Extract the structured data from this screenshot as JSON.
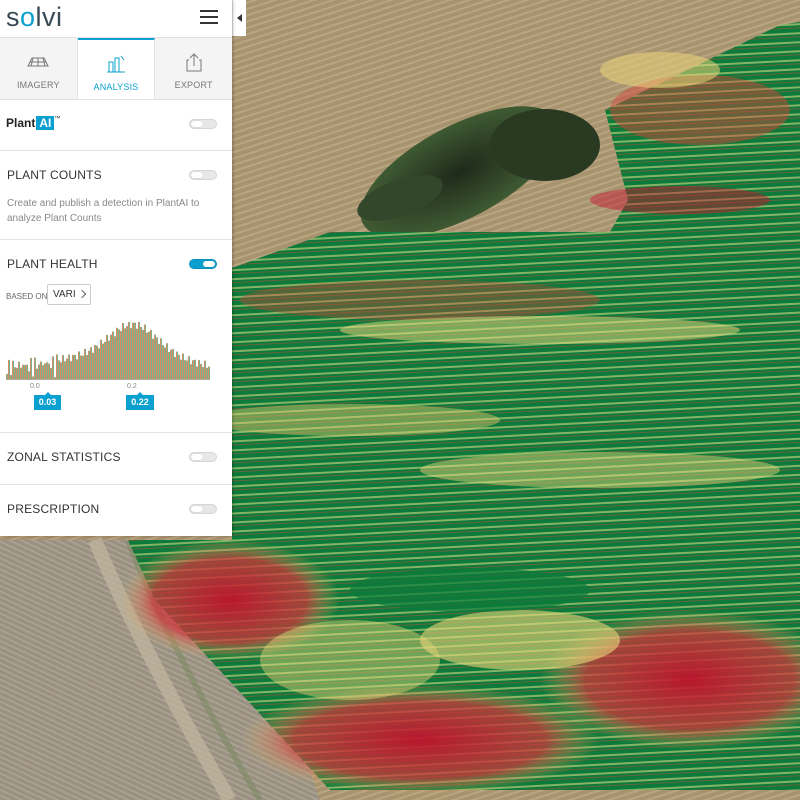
{
  "app": {
    "logo_text": "solvi",
    "menu_icon": "hamburger-icon",
    "collapse_icon": "caret-left-icon"
  },
  "tabs": [
    {
      "label": "IMAGERY",
      "icon": "drone-grid-icon",
      "active": false
    },
    {
      "label": "ANALYSIS",
      "icon": "analysis-chart-icon",
      "active": true
    },
    {
      "label": "EXPORT",
      "icon": "export-share-icon",
      "active": false
    }
  ],
  "plantai": {
    "brand": "Plant",
    "brand_accent": "AI",
    "trademark": "™",
    "toggle_on": false
  },
  "plant_counts": {
    "title": "PLANT COUNTS",
    "description": "Create and publish a detection in PlantAI to analyze Plant Counts",
    "toggle_on": false
  },
  "plant_health": {
    "title": "PLANT HEALTH",
    "toggle_on": true,
    "based_on_label": "BASED ON",
    "index_value": "VARI",
    "histogram": {
      "tick_labels": [
        "0.0",
        "0.2"
      ],
      "range_low": "0.03",
      "range_high": "0.22"
    }
  },
  "zonal_statistics": {
    "title": "ZONAL STATISTICS",
    "toggle_on": false
  },
  "prescription": {
    "title": "PRESCRIPTION",
    "toggle_on": false
  },
  "colors": {
    "accent": "#0aa0cf",
    "health_low": "#c8102e",
    "health_mid": "#f6e98c",
    "health_high": "#0b7a3a"
  }
}
